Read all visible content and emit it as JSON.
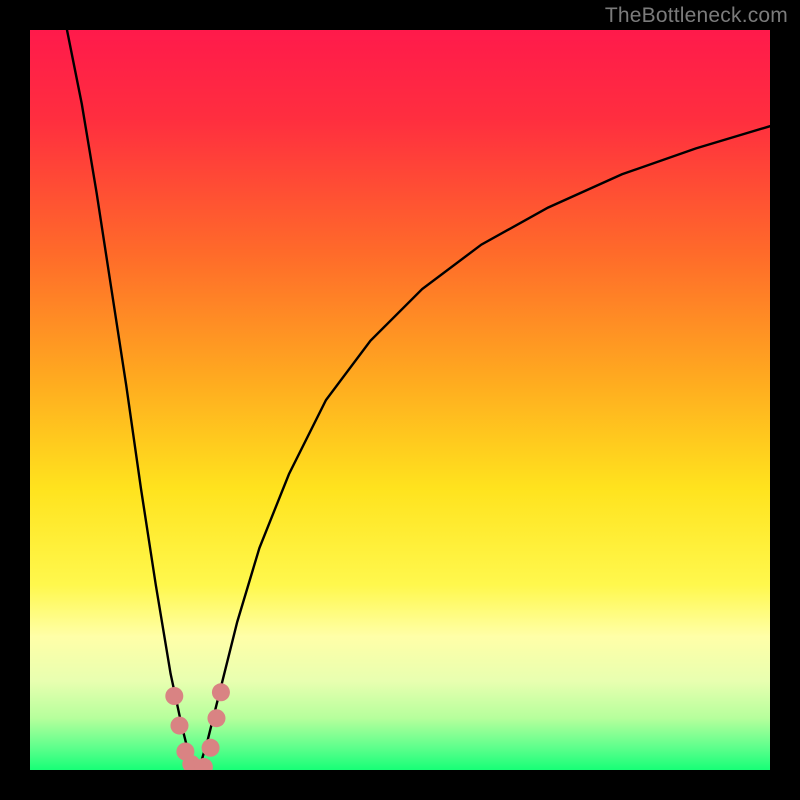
{
  "watermark": "TheBottleneck.com",
  "chart_data": {
    "type": "line",
    "title": "",
    "xlabel": "",
    "ylabel": "",
    "x_range": [
      0,
      100
    ],
    "y_range": [
      0,
      100
    ],
    "gradient_stops": [
      {
        "offset": 0.0,
        "color": "#ff1a4b"
      },
      {
        "offset": 0.12,
        "color": "#ff2e3f"
      },
      {
        "offset": 0.3,
        "color": "#ff6a2a"
      },
      {
        "offset": 0.48,
        "color": "#ffad1f"
      },
      {
        "offset": 0.62,
        "color": "#ffe31e"
      },
      {
        "offset": 0.75,
        "color": "#fff84d"
      },
      {
        "offset": 0.82,
        "color": "#ffffa8"
      },
      {
        "offset": 0.88,
        "color": "#e8ffb0"
      },
      {
        "offset": 0.93,
        "color": "#b6ff9c"
      },
      {
        "offset": 0.97,
        "color": "#5dff8c"
      },
      {
        "offset": 1.0,
        "color": "#17ff77"
      }
    ],
    "series": [
      {
        "name": "left_curve",
        "x": [
          5,
          7,
          9,
          11,
          13,
          15,
          17,
          19,
          20.5,
          21.5,
          22.3,
          22.8
        ],
        "y": [
          100,
          90,
          78,
          65,
          52,
          38,
          25,
          13,
          6,
          2,
          0.5,
          0
        ]
      },
      {
        "name": "right_curve",
        "x": [
          22.8,
          24,
          26,
          28,
          31,
          35,
          40,
          46,
          53,
          61,
          70,
          80,
          90,
          100
        ],
        "y": [
          0,
          4,
          12,
          20,
          30,
          40,
          50,
          58,
          65,
          71,
          76,
          80.5,
          84,
          87
        ]
      }
    ],
    "markers": {
      "name": "pink_dots",
      "color": "#d98383",
      "radius": 9,
      "points": [
        {
          "x": 19.5,
          "y": 10
        },
        {
          "x": 20.2,
          "y": 6
        },
        {
          "x": 21.0,
          "y": 2.5
        },
        {
          "x": 21.8,
          "y": 0.8
        },
        {
          "x": 22.6,
          "y": 0.2
        },
        {
          "x": 23.5,
          "y": 0.4
        },
        {
          "x": 24.4,
          "y": 3
        },
        {
          "x": 25.2,
          "y": 7
        },
        {
          "x": 25.8,
          "y": 10.5
        }
      ]
    }
  }
}
